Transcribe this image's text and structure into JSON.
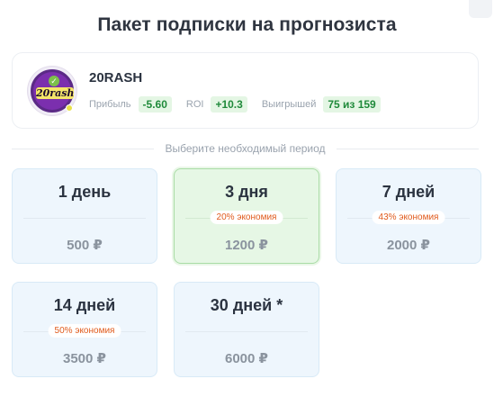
{
  "header": {
    "title": "Пакет подписки на прогнозиста"
  },
  "profile": {
    "avatar_text": "20rash",
    "username": "20RASH",
    "stats": [
      {
        "label": "Прибыль",
        "value": "-5.60"
      },
      {
        "label": "ROI",
        "value": "+10.3"
      },
      {
        "label": "Выигрышей",
        "value": "75 из 159"
      }
    ]
  },
  "period_prompt": "Выберите необходимый период",
  "plans": [
    {
      "name": "1 день",
      "badge": "",
      "price": "500 ₽",
      "selected": false
    },
    {
      "name": "3 дня",
      "badge": "20% экономия",
      "price": "1200 ₽",
      "selected": true
    },
    {
      "name": "7 дней",
      "badge": "43% экономия",
      "price": "2000 ₽",
      "selected": false
    },
    {
      "name": "14 дней",
      "badge": "50% экономия",
      "price": "3500 ₽",
      "selected": false
    },
    {
      "name": "30 дней *",
      "badge": "",
      "price": "6000 ₽",
      "selected": false
    }
  ],
  "colors": {
    "positive": "#1f8a3a",
    "positive_bg": "#e4f6e4",
    "badge_text": "#e05a1c",
    "card_bg": "#eef6fd",
    "card_selected_bg": "#e6f7e5"
  }
}
